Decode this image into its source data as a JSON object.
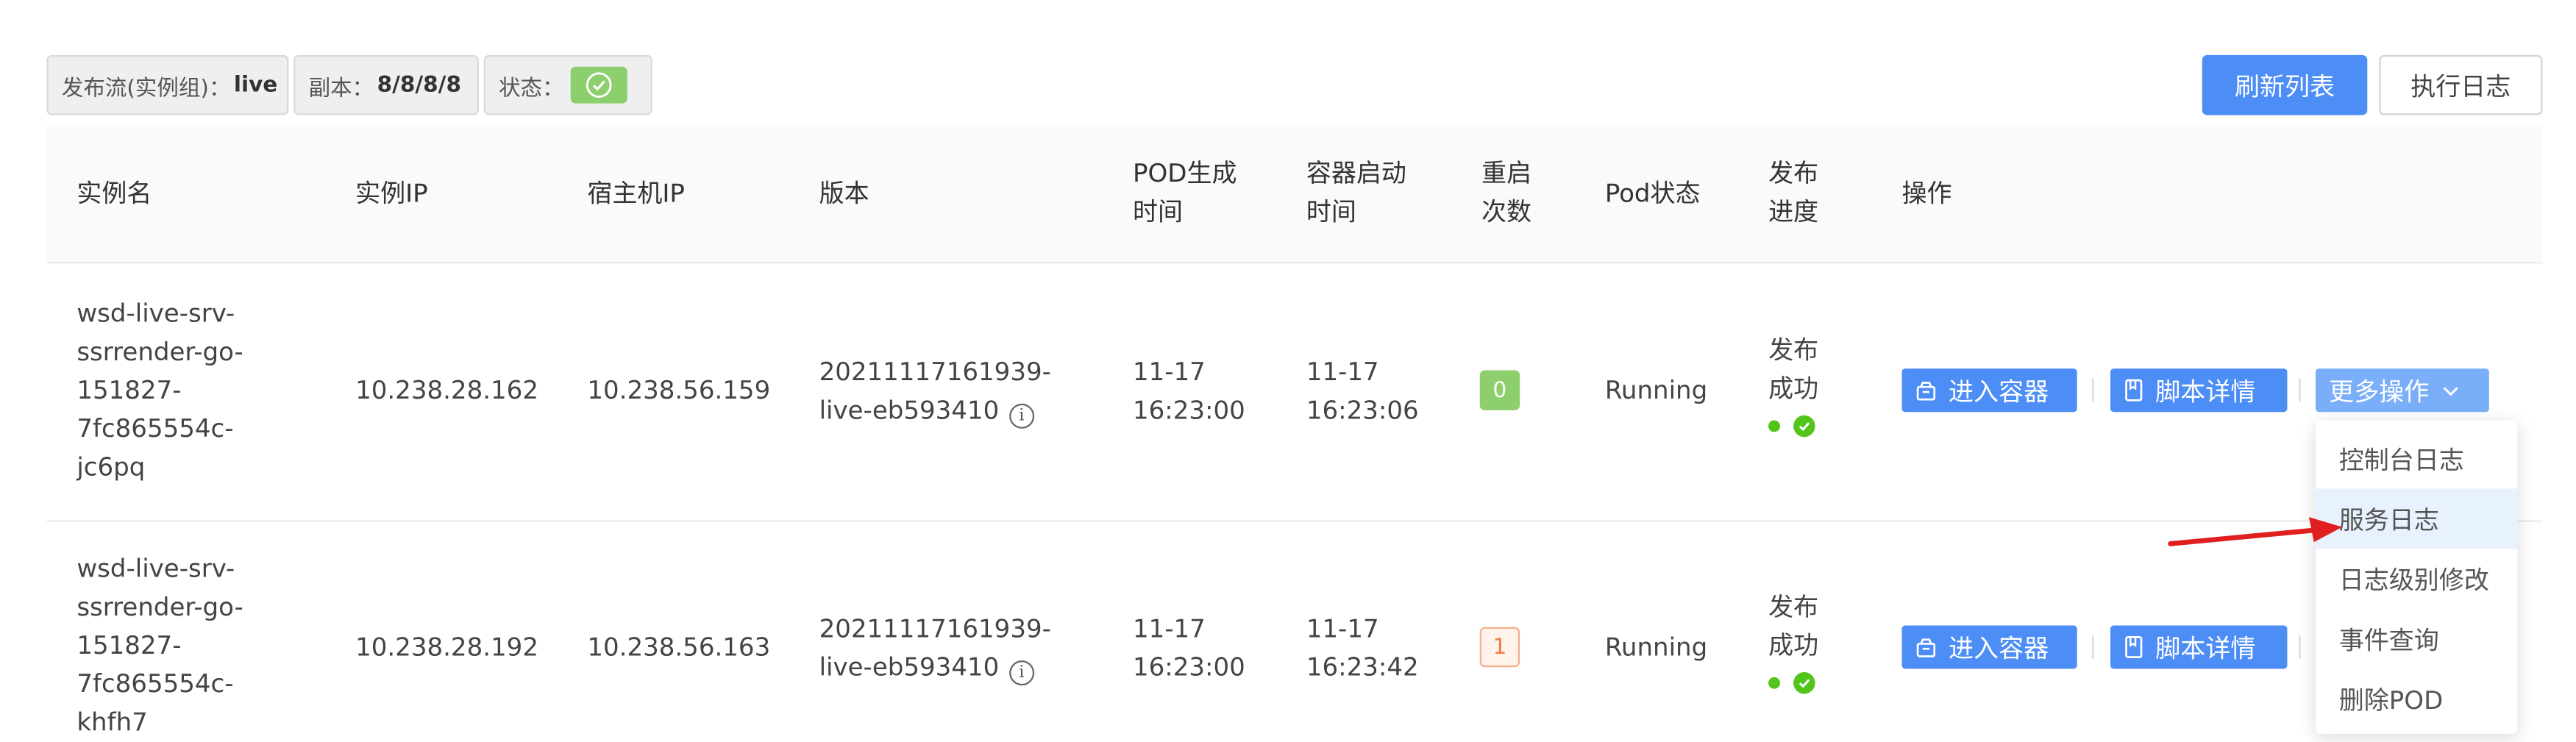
{
  "summary": {
    "flow_label": "发布流(实例组)：",
    "flow_value": "live",
    "replica_label": "副本：",
    "replica_value": "8/8/8/8",
    "status_label": "状态："
  },
  "toolbar": {
    "refresh_label": "刷新列表",
    "log_label": "执行日志"
  },
  "columns": [
    "实例名",
    "实例IP",
    "宿主机IP",
    "版本",
    "POD生成\n时间",
    "容器启动\n时间",
    "重启\n次数",
    "Pod状态",
    "发布\n进度",
    "操作"
  ],
  "rows": [
    {
      "name": "wsd-live-srv-\nssrrender-go-\n151827-\n7fc865554c-\njc6pq",
      "ip": "10.238.28.162",
      "host_ip": "10.238.56.159",
      "version": "20211117161939-\nlive-eb593410",
      "pod_time": "11-17\n16:23:00",
      "start_time": "11-17\n16:23:06",
      "restarts": "0",
      "pod_status": "Running",
      "progress": "发布\n成功"
    },
    {
      "name": "wsd-live-srv-\nssrrender-go-\n151827-\n7fc865554c-\nkhfh7",
      "ip": "10.238.28.192",
      "host_ip": "10.238.56.163",
      "version": "20211117161939-\nlive-eb593410",
      "pod_time": "11-17\n16:23:00",
      "start_time": "11-17\n16:23:42",
      "restarts": "1",
      "pod_status": "Running",
      "progress": "发布\n成功"
    }
  ],
  "actions": {
    "enter_container": "进入容器",
    "script_detail": "脚本详情",
    "more": "更多操作"
  },
  "dropdown": {
    "items": [
      "控制台日志",
      "服务日志",
      "日志级别修改",
      "事件查询",
      "删除POD"
    ],
    "active_index": 1
  },
  "colors": {
    "primary": "#4c8df6",
    "success": "#8dcf6d",
    "warning": "#f07a45",
    "pointer_arrow": "#e02020"
  },
  "icons": {
    "info": "info-icon",
    "container": "container-icon",
    "script": "document-icon",
    "chevron": "chevron-down-icon",
    "check": "check-circle-icon",
    "arrow": "pointer-arrow-icon"
  }
}
